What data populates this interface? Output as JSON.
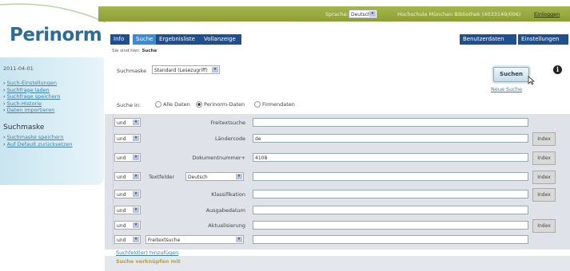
{
  "topbar": {
    "sprache_label": "Sprache:",
    "sprache_value": "Deutsch",
    "library": "Hochschule München Bibliothek (4033149/006)",
    "logout": "Einloggen"
  },
  "logo": "Perinorm",
  "sidebar": {
    "date": "2011-04-01",
    "links": [
      "Such-Einstellungen",
      "Suchfrage laden",
      "Suchfrage speichern",
      "Such-Historie",
      "Daten importieren"
    ],
    "section_title": "Suchmaske",
    "section_links": [
      "Suchmaske speichern",
      "Auf Default zurücksetzen"
    ]
  },
  "tabs": [
    "Info",
    "Suche",
    "Ergebnisliste",
    "Vollanzeige"
  ],
  "right_tabs": [
    "Benutzerdaten",
    "Einstellungen"
  ],
  "breadcrumb": {
    "prefix": "Sie sind hier:",
    "current": "Suche"
  },
  "suchmaske": {
    "label": "Suchmaske",
    "value": "Standard (Lesezugriff)"
  },
  "search_button": "Suchen",
  "new_search": "Neue Suche",
  "info_icon": "info-icon",
  "suche_in": {
    "label": "Suche in:",
    "options": [
      "Alle Daten",
      "Perinorm-Daten",
      "Firmendaten"
    ],
    "selected": "Perinorm-Daten"
  },
  "rows": [
    {
      "op": "und",
      "label": "Freitextsuche",
      "value": "",
      "index": ""
    },
    {
      "op": "und",
      "label": "Ländercode",
      "value": "de",
      "index": "Index"
    },
    {
      "op": "und",
      "label": "Dokumentnummer+",
      "value": "4108",
      "index": "Index"
    },
    {
      "op": "und",
      "label": "Textfelder",
      "select": "Deutsch",
      "value": "",
      "index": "Index"
    },
    {
      "op": "und",
      "label": "Klassifikation",
      "value": "",
      "index": "Index"
    },
    {
      "op": "und",
      "label": "Ausgabedatum",
      "value": "",
      "index": ""
    },
    {
      "op": "und",
      "label": "Aktualisierung",
      "value": "",
      "index": "Index"
    },
    {
      "op": "und",
      "select": "Freitextsuche",
      "value": "",
      "index": ""
    }
  ],
  "add_fields": "Suchfeld(er) hinzufügen",
  "connect_title": "Suche verknüpfen mit",
  "colors": {
    "topbar": "#9aac40",
    "tab": "#1f4f8e",
    "tab_active": "#3d8ad4",
    "logo": "#2d6d94",
    "link": "#3a7fb0",
    "connect": "#b8a13a"
  }
}
